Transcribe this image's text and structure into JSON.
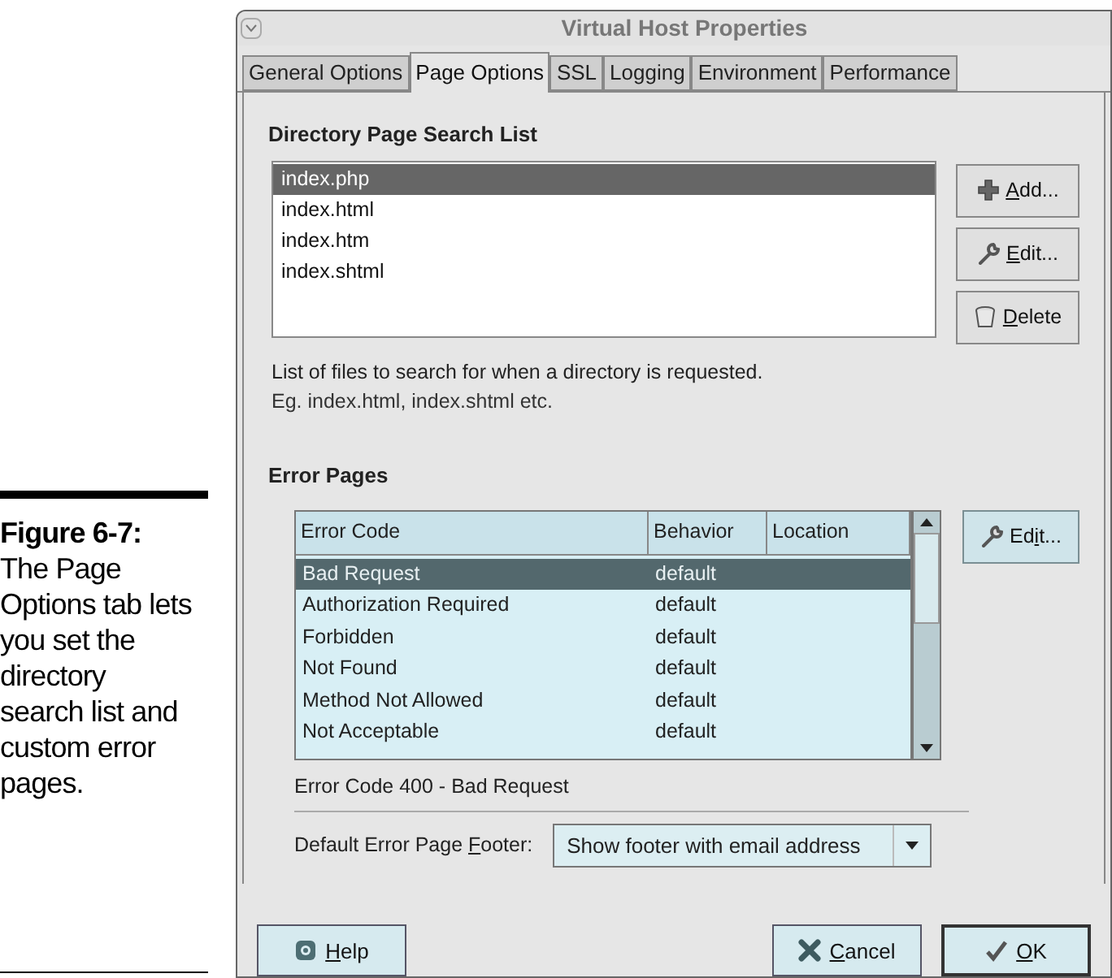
{
  "caption": {
    "label": "Figure 6-7:",
    "text": "The Page Options tab lets you set the directory search list and custom error pages."
  },
  "window": {
    "title": "Virtual Host Properties"
  },
  "tabs": [
    {
      "label": "General Options",
      "selected": false
    },
    {
      "label": "Page Options",
      "selected": true
    },
    {
      "label": "SSL",
      "selected": false
    },
    {
      "label": "Logging",
      "selected": false
    },
    {
      "label": "Environment",
      "selected": false
    },
    {
      "label": "Performance",
      "selected": false
    }
  ],
  "search_list": {
    "heading": "Directory Page Search List",
    "items": [
      {
        "label": "index.php",
        "selected": true
      },
      {
        "label": "index.html",
        "selected": false
      },
      {
        "label": "index.htm",
        "selected": false
      },
      {
        "label": "index.shtml",
        "selected": false
      }
    ],
    "buttons": [
      {
        "kind": "add",
        "mnemonic": "A",
        "label_end": "dd..."
      },
      {
        "kind": "edit",
        "mnemonic": "E",
        "label_end": "dit..."
      },
      {
        "kind": "delete",
        "mnemonic": "D",
        "label_end": "elete"
      }
    ],
    "hint": [
      "List of files to search for when a directory is requested.",
      "Eg. index.html, index.shtml etc."
    ]
  },
  "error_pages": {
    "heading": "Error Pages",
    "columns": [
      "Error Code",
      "Behavior",
      "Location"
    ],
    "rows": [
      {
        "code": "Bad Request",
        "behavior": "default",
        "selected": true
      },
      {
        "code": "Authorization Required",
        "behavior": "default",
        "selected": false
      },
      {
        "code": "Forbidden",
        "behavior": "default",
        "selected": false
      },
      {
        "code": "Not Found",
        "behavior": "default",
        "selected": false
      },
      {
        "code": "Method Not Allowed",
        "behavior": "default",
        "selected": false
      },
      {
        "code": "Not Acceptable",
        "behavior": "default",
        "selected": false
      }
    ],
    "edit_button": {
      "label_start": "Ed",
      "mnemonic": "i",
      "label_end": "t..."
    },
    "detail": "Error Code 400 - Bad Request",
    "footer_label": {
      "label_start": "Default Error Page ",
      "mnemonic": "F",
      "label_end": "ooter:"
    },
    "footer_value": "Show footer with email address"
  },
  "buttons": [
    {
      "kind": "help",
      "mnemonic": "H",
      "label_end": "elp"
    },
    {
      "kind": "cancel",
      "mnemonic": "C",
      "label_end": "ancel"
    },
    {
      "kind": "ok",
      "mnemonic": "O",
      "label_end": "K"
    }
  ]
}
